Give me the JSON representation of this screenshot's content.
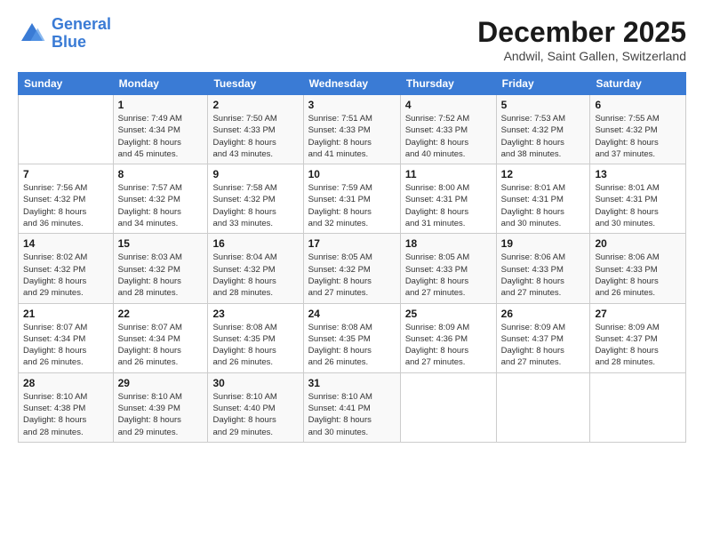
{
  "header": {
    "logo_line1": "General",
    "logo_line2": "Blue",
    "month_title": "December 2025",
    "location": "Andwil, Saint Gallen, Switzerland"
  },
  "days_of_week": [
    "Sunday",
    "Monday",
    "Tuesday",
    "Wednesday",
    "Thursday",
    "Friday",
    "Saturday"
  ],
  "weeks": [
    [
      {
        "num": "",
        "info": ""
      },
      {
        "num": "1",
        "info": "Sunrise: 7:49 AM\nSunset: 4:34 PM\nDaylight: 8 hours\nand 45 minutes."
      },
      {
        "num": "2",
        "info": "Sunrise: 7:50 AM\nSunset: 4:33 PM\nDaylight: 8 hours\nand 43 minutes."
      },
      {
        "num": "3",
        "info": "Sunrise: 7:51 AM\nSunset: 4:33 PM\nDaylight: 8 hours\nand 41 minutes."
      },
      {
        "num": "4",
        "info": "Sunrise: 7:52 AM\nSunset: 4:33 PM\nDaylight: 8 hours\nand 40 minutes."
      },
      {
        "num": "5",
        "info": "Sunrise: 7:53 AM\nSunset: 4:32 PM\nDaylight: 8 hours\nand 38 minutes."
      },
      {
        "num": "6",
        "info": "Sunrise: 7:55 AM\nSunset: 4:32 PM\nDaylight: 8 hours\nand 37 minutes."
      }
    ],
    [
      {
        "num": "7",
        "info": "Sunrise: 7:56 AM\nSunset: 4:32 PM\nDaylight: 8 hours\nand 36 minutes."
      },
      {
        "num": "8",
        "info": "Sunrise: 7:57 AM\nSunset: 4:32 PM\nDaylight: 8 hours\nand 34 minutes."
      },
      {
        "num": "9",
        "info": "Sunrise: 7:58 AM\nSunset: 4:32 PM\nDaylight: 8 hours\nand 33 minutes."
      },
      {
        "num": "10",
        "info": "Sunrise: 7:59 AM\nSunset: 4:31 PM\nDaylight: 8 hours\nand 32 minutes."
      },
      {
        "num": "11",
        "info": "Sunrise: 8:00 AM\nSunset: 4:31 PM\nDaylight: 8 hours\nand 31 minutes."
      },
      {
        "num": "12",
        "info": "Sunrise: 8:01 AM\nSunset: 4:31 PM\nDaylight: 8 hours\nand 30 minutes."
      },
      {
        "num": "13",
        "info": "Sunrise: 8:01 AM\nSunset: 4:31 PM\nDaylight: 8 hours\nand 30 minutes."
      }
    ],
    [
      {
        "num": "14",
        "info": "Sunrise: 8:02 AM\nSunset: 4:32 PM\nDaylight: 8 hours\nand 29 minutes."
      },
      {
        "num": "15",
        "info": "Sunrise: 8:03 AM\nSunset: 4:32 PM\nDaylight: 8 hours\nand 28 minutes."
      },
      {
        "num": "16",
        "info": "Sunrise: 8:04 AM\nSunset: 4:32 PM\nDaylight: 8 hours\nand 28 minutes."
      },
      {
        "num": "17",
        "info": "Sunrise: 8:05 AM\nSunset: 4:32 PM\nDaylight: 8 hours\nand 27 minutes."
      },
      {
        "num": "18",
        "info": "Sunrise: 8:05 AM\nSunset: 4:33 PM\nDaylight: 8 hours\nand 27 minutes."
      },
      {
        "num": "19",
        "info": "Sunrise: 8:06 AM\nSunset: 4:33 PM\nDaylight: 8 hours\nand 27 minutes."
      },
      {
        "num": "20",
        "info": "Sunrise: 8:06 AM\nSunset: 4:33 PM\nDaylight: 8 hours\nand 26 minutes."
      }
    ],
    [
      {
        "num": "21",
        "info": "Sunrise: 8:07 AM\nSunset: 4:34 PM\nDaylight: 8 hours\nand 26 minutes."
      },
      {
        "num": "22",
        "info": "Sunrise: 8:07 AM\nSunset: 4:34 PM\nDaylight: 8 hours\nand 26 minutes."
      },
      {
        "num": "23",
        "info": "Sunrise: 8:08 AM\nSunset: 4:35 PM\nDaylight: 8 hours\nand 26 minutes."
      },
      {
        "num": "24",
        "info": "Sunrise: 8:08 AM\nSunset: 4:35 PM\nDaylight: 8 hours\nand 26 minutes."
      },
      {
        "num": "25",
        "info": "Sunrise: 8:09 AM\nSunset: 4:36 PM\nDaylight: 8 hours\nand 27 minutes."
      },
      {
        "num": "26",
        "info": "Sunrise: 8:09 AM\nSunset: 4:37 PM\nDaylight: 8 hours\nand 27 minutes."
      },
      {
        "num": "27",
        "info": "Sunrise: 8:09 AM\nSunset: 4:37 PM\nDaylight: 8 hours\nand 28 minutes."
      }
    ],
    [
      {
        "num": "28",
        "info": "Sunrise: 8:10 AM\nSunset: 4:38 PM\nDaylight: 8 hours\nand 28 minutes."
      },
      {
        "num": "29",
        "info": "Sunrise: 8:10 AM\nSunset: 4:39 PM\nDaylight: 8 hours\nand 29 minutes."
      },
      {
        "num": "30",
        "info": "Sunrise: 8:10 AM\nSunset: 4:40 PM\nDaylight: 8 hours\nand 29 minutes."
      },
      {
        "num": "31",
        "info": "Sunrise: 8:10 AM\nSunset: 4:41 PM\nDaylight: 8 hours\nand 30 minutes."
      },
      {
        "num": "",
        "info": ""
      },
      {
        "num": "",
        "info": ""
      },
      {
        "num": "",
        "info": ""
      }
    ]
  ]
}
